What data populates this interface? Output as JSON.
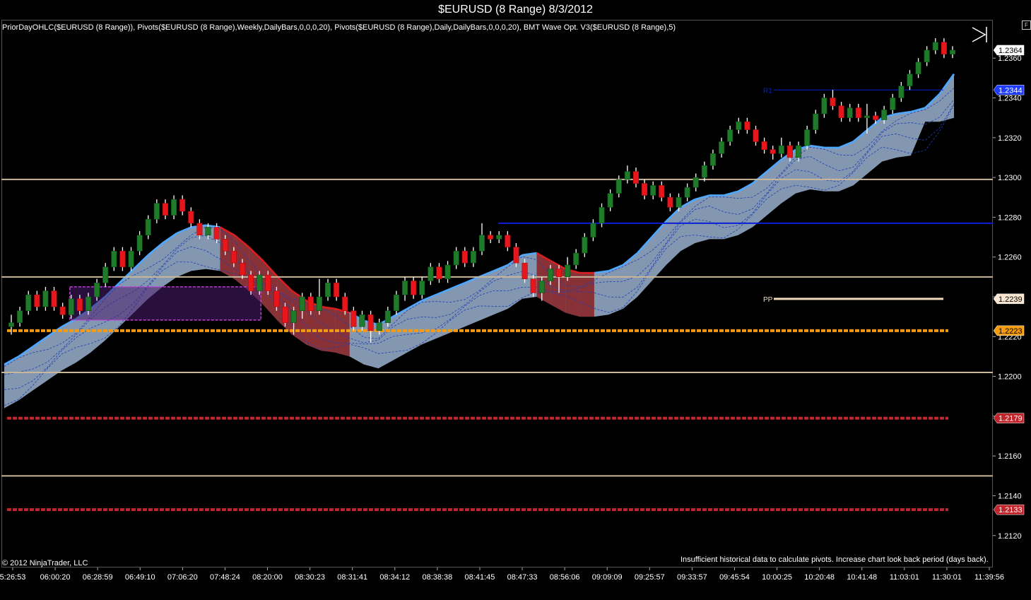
{
  "window": {
    "title": "$EURUSD (8 Range)  8/3/2012"
  },
  "indicators_label": "PriorDayOHLC($EURUSD (8 Range)), Pivots($EURUSD (8 Range),Weekly,DailyBars,0,0,0,20), Pivots($EURUSD (8 Range),Daily,DailyBars,0,0,0,20), BMT Wave Opt. V3($EURUSD (8 Range),5)",
  "corner_button": "F",
  "copyright": "© 2012 NinjaTrader, LLC",
  "pivot_note": "Insufficient historical data to calculate pivots. Increase chart look back period (days back).",
  "colors": {
    "background": "#000000",
    "up_candle": "#1f7a2a",
    "down_candle": "#e8161b",
    "wave_up": "#4fa8ff",
    "wave_down": "#d81e1e",
    "band_fill": "#a9c2e2",
    "resistance": "#0b1fd6",
    "pp_line": "#f4d9bb",
    "orange_level": "#f39c12",
    "red_level": "#c0272d",
    "tan_level": "#c9b79a"
  },
  "chart_data": {
    "type": "candlestick",
    "title": "$EURUSD (8 Range)  8/3/2012",
    "ylim": [
      1.2105,
      1.2375
    ],
    "y_ticks": [
      "1.2120",
      "1.2140",
      "1.2160",
      "1.2180",
      "1.2200",
      "1.2220",
      "1.2240",
      "1.2260",
      "1.2280",
      "1.2300",
      "1.2320",
      "1.2340",
      "1.2360"
    ],
    "x_ticks": [
      "5:26:53",
      "06:00:20",
      "06:28:59",
      "06:49:10",
      "07:06:20",
      "07:48:24",
      "08:20:00",
      "08:30:23",
      "08:31:41",
      "08:34:12",
      "08:38:38",
      "08:41:45",
      "08:47:33",
      "08:56:06",
      "09:09:09",
      "09:25:57",
      "09:33:57",
      "09:45:54",
      "10:00:25",
      "10:20:48",
      "10:41:48",
      "11:03:01",
      "11:30:01",
      "11:39:56"
    ],
    "price_markers": [
      {
        "label": "1.2364",
        "value": 1.2364,
        "color": "#ffffff",
        "text_color": "#000000"
      },
      {
        "label": "1.2344",
        "value": 1.2344,
        "color": "#1f3cff",
        "text_color": "#ffffff"
      },
      {
        "label": "1.2239",
        "value": 1.2239,
        "color": "#f8e6d0",
        "text_color": "#000000"
      },
      {
        "label": "1.2223",
        "value": 1.2223,
        "color": "#f39c12",
        "text_color": "#000000"
      },
      {
        "label": "1.2179",
        "value": 1.2179,
        "color": "#c0272d",
        "text_color": "#ffffff"
      },
      {
        "label": "1.2133",
        "value": 1.2133,
        "color": "#c0272d",
        "text_color": "#ffffff"
      }
    ],
    "levels": [
      {
        "name": "tan-level-1",
        "value": 1.2299,
        "style": "solid",
        "color": "#c9b79a"
      },
      {
        "name": "tan-level-2",
        "value": 1.225,
        "style": "solid",
        "color": "#c9b79a"
      },
      {
        "name": "tan-level-3",
        "value": 1.2202,
        "style": "solid",
        "color": "#c9b79a"
      },
      {
        "name": "tan-level-4",
        "value": 1.215,
        "style": "solid",
        "color": "#c9b79a"
      },
      {
        "name": "blue-resistance",
        "value": 1.2277,
        "style": "solid",
        "color": "#0b1fd6"
      },
      {
        "name": "orange-level",
        "value": 1.2223,
        "style": "dashed",
        "color": "#f39c12"
      },
      {
        "name": "red-level-1",
        "value": 1.2179,
        "style": "dashed",
        "color": "#c0272d"
      },
      {
        "name": "red-level-2",
        "value": 1.2133,
        "style": "dashed",
        "color": "#c0272d"
      }
    ],
    "pivot_labels": [
      {
        "label": "R1",
        "value": 1.2344
      },
      {
        "label": "PP",
        "value": 1.2239
      }
    ],
    "candles": [
      [
        1.2225,
        1.2227,
        1.2231,
        1.2221
      ],
      [
        1.2227,
        1.2233,
        1.2235,
        1.2225
      ],
      [
        1.2233,
        1.2241,
        1.2243,
        1.2231
      ],
      [
        1.2241,
        1.2235,
        1.2243,
        1.2233
      ],
      [
        1.2235,
        1.2243,
        1.2245,
        1.2233
      ],
      [
        1.2243,
        1.2235,
        1.2245,
        1.2233
      ],
      [
        1.2235,
        1.2231,
        1.2237,
        1.2229
      ],
      [
        1.2231,
        1.2239,
        1.2241,
        1.2229
      ],
      [
        1.2239,
        1.2233,
        1.2241,
        1.2231
      ],
      [
        1.2233,
        1.224,
        1.2242,
        1.2231
      ],
      [
        1.224,
        1.2247,
        1.2249,
        1.2238
      ],
      [
        1.2247,
        1.2255,
        1.2257,
        1.2245
      ],
      [
        1.2255,
        1.2263,
        1.2265,
        1.2253
      ],
      [
        1.2263,
        1.2255,
        1.2265,
        1.2253
      ],
      [
        1.2255,
        1.2263,
        1.2265,
        1.2253
      ],
      [
        1.2263,
        1.2271,
        1.2273,
        1.2261
      ],
      [
        1.2271,
        1.2279,
        1.2281,
        1.2269
      ],
      [
        1.2279,
        1.2287,
        1.2289,
        1.2277
      ],
      [
        1.2287,
        1.2281,
        1.2289,
        1.2279
      ],
      [
        1.2281,
        1.2289,
        1.2291,
        1.2279
      ],
      [
        1.2289,
        1.2283,
        1.2291,
        1.2281
      ],
      [
        1.2283,
        1.2277,
        1.2285,
        1.2275
      ],
      [
        1.2277,
        1.2271,
        1.2279,
        1.2269
      ],
      [
        1.2271,
        1.2275,
        1.2277,
        1.2269
      ],
      [
        1.2275,
        1.2269,
        1.2277,
        1.2267
      ],
      [
        1.2269,
        1.2263,
        1.2271,
        1.2261
      ],
      [
        1.2263,
        1.2257,
        1.2265,
        1.2255
      ],
      [
        1.2257,
        1.2251,
        1.2259,
        1.2249
      ],
      [
        1.2251,
        1.2243,
        1.2253,
        1.2241
      ],
      [
        1.2243,
        1.2251,
        1.2253,
        1.2241
      ],
      [
        1.2251,
        1.2243,
        1.2253,
        1.2241
      ],
      [
        1.2243,
        1.2235,
        1.2245,
        1.2233
      ],
      [
        1.2235,
        1.2227,
        1.2237,
        1.2225
      ],
      [
        1.2227,
        1.2233,
        1.2235,
        1.2221
      ],
      [
        1.2233,
        1.224,
        1.2242,
        1.2229
      ],
      [
        1.224,
        1.2233,
        1.2242,
        1.2231
      ],
      [
        1.2233,
        1.224,
        1.2249,
        1.2231
      ],
      [
        1.224,
        1.2247,
        1.2249,
        1.2238
      ],
      [
        1.2247,
        1.224,
        1.2249,
        1.2238
      ],
      [
        1.224,
        1.2233,
        1.2242,
        1.2231
      ],
      [
        1.2233,
        1.2225,
        1.2235,
        1.2223
      ],
      [
        1.2225,
        1.2231,
        1.2233,
        1.2223
      ],
      [
        1.2231,
        1.2223,
        1.2233,
        1.2217
      ],
      [
        1.2223,
        1.2227,
        1.2229,
        1.2221
      ],
      [
        1.2227,
        1.2233,
        1.2235,
        1.2225
      ],
      [
        1.2233,
        1.2241,
        1.2243,
        1.2231
      ],
      [
        1.2241,
        1.2248,
        1.225,
        1.2238
      ],
      [
        1.2248,
        1.2241,
        1.225,
        1.2239
      ],
      [
        1.2241,
        1.2248,
        1.225,
        1.2239
      ],
      [
        1.2248,
        1.2255,
        1.2257,
        1.2246
      ],
      [
        1.2255,
        1.2249,
        1.2257,
        1.2247
      ],
      [
        1.2249,
        1.2256,
        1.2258,
        1.2247
      ],
      [
        1.2256,
        1.2263,
        1.2265,
        1.2254
      ],
      [
        1.2263,
        1.2257,
        1.2265,
        1.2255
      ],
      [
        1.2257,
        1.2263,
        1.2265,
        1.2255
      ],
      [
        1.2263,
        1.2271,
        1.2277,
        1.2261
      ],
      [
        1.2271,
        1.2269,
        1.2273,
        1.2267
      ],
      [
        1.2269,
        1.2271,
        1.2273,
        1.2267
      ],
      [
        1.2271,
        1.2265,
        1.2273,
        1.2263
      ],
      [
        1.2265,
        1.2257,
        1.2267,
        1.2255
      ],
      [
        1.2257,
        1.2249,
        1.2259,
        1.2247
      ],
      [
        1.2249,
        1.2242,
        1.2251,
        1.224
      ],
      [
        1.2242,
        1.2248,
        1.225,
        1.2238
      ],
      [
        1.2248,
        1.2254,
        1.2256,
        1.2246
      ],
      [
        1.2254,
        1.225,
        1.2256,
        1.2242
      ],
      [
        1.225,
        1.2256,
        1.226,
        1.2248
      ],
      [
        1.2256,
        1.2262,
        1.2264,
        1.2254
      ],
      [
        1.2262,
        1.227,
        1.2272,
        1.226
      ],
      [
        1.227,
        1.2277,
        1.2279,
        1.2268
      ],
      [
        1.2277,
        1.2285,
        1.2287,
        1.2275
      ],
      [
        1.2285,
        1.2292,
        1.2294,
        1.2283
      ],
      [
        1.2292,
        1.2299,
        1.2301,
        1.229
      ],
      [
        1.2299,
        1.2303,
        1.2306,
        1.2297
      ],
      [
        1.2303,
        1.2297,
        1.2305,
        1.2295
      ],
      [
        1.2297,
        1.2291,
        1.2299,
        1.2289
      ],
      [
        1.2291,
        1.2296,
        1.2298,
        1.2289
      ],
      [
        1.2296,
        1.229,
        1.2298,
        1.2288
      ],
      [
        1.229,
        1.2285,
        1.2292,
        1.2283
      ],
      [
        1.2285,
        1.229,
        1.2292,
        1.2283
      ],
      [
        1.229,
        1.2295,
        1.2297,
        1.2288
      ],
      [
        1.2295,
        1.23,
        1.2302,
        1.2293
      ],
      [
        1.23,
        1.2306,
        1.2308,
        1.2298
      ],
      [
        1.2306,
        1.2312,
        1.2314,
        1.2304
      ],
      [
        1.2312,
        1.2318,
        1.232,
        1.231
      ],
      [
        1.2318,
        1.2324,
        1.2326,
        1.2316
      ],
      [
        1.2324,
        1.2328,
        1.233,
        1.2322
      ],
      [
        1.2328,
        1.2324,
        1.233,
        1.2322
      ],
      [
        1.2324,
        1.2318,
        1.2326,
        1.2316
      ],
      [
        1.2318,
        1.2314,
        1.232,
        1.2312
      ],
      [
        1.2314,
        1.2312,
        1.2316,
        1.2309
      ],
      [
        1.2312,
        1.2316,
        1.232,
        1.231
      ],
      [
        1.2316,
        1.231,
        1.2318,
        1.2308
      ],
      [
        1.231,
        1.2316,
        1.2318,
        1.2308
      ],
      [
        1.2316,
        1.2324,
        1.2326,
        1.2314
      ],
      [
        1.2324,
        1.2332,
        1.2334,
        1.2322
      ],
      [
        1.2332,
        1.234,
        1.2342,
        1.233
      ],
      [
        1.234,
        1.2336,
        1.2344,
        1.2334
      ],
      [
        1.2336,
        1.233,
        1.2338,
        1.2328
      ],
      [
        1.233,
        1.2335,
        1.2337,
        1.2328
      ],
      [
        1.2335,
        1.233,
        1.2337,
        1.2328
      ],
      [
        1.233,
        1.2331,
        1.2337,
        1.2322
      ],
      [
        1.2331,
        1.2329,
        1.2333,
        1.2327
      ],
      [
        1.2329,
        1.2334,
        1.2336,
        1.2327
      ],
      [
        1.2334,
        1.234,
        1.2342,
        1.2332
      ],
      [
        1.234,
        1.2346,
        1.2348,
        1.2338
      ],
      [
        1.2346,
        1.2352,
        1.2354,
        1.2344
      ],
      [
        1.2352,
        1.2358,
        1.236,
        1.235
      ],
      [
        1.2358,
        1.2364,
        1.2366,
        1.2356
      ],
      [
        1.2364,
        1.2368,
        1.237,
        1.2362
      ],
      [
        1.2368,
        1.2362,
        1.237,
        1.236
      ],
      [
        1.2362,
        1.2364,
        1.2366,
        1.236
      ]
    ],
    "wave_centerline": [
      1.2206,
      1.221,
      1.2215,
      1.222,
      1.2225,
      1.2229,
      1.2234,
      1.224,
      1.2247,
      1.2254,
      1.2261,
      1.2267,
      1.2272,
      1.2275,
      1.2276,
      1.2275,
      1.2271,
      1.2265,
      1.2258,
      1.225,
      1.2243,
      1.2238,
      1.2235,
      1.2234,
      1.2232,
      1.2228,
      1.2226,
      1.223,
      1.2234,
      1.2238,
      1.2241,
      1.2244,
      1.2247,
      1.225,
      1.2253,
      1.2256,
      1.2261,
      1.2262,
      1.2258,
      1.2254,
      1.2252,
      1.2252,
      1.2253,
      1.2256,
      1.2262,
      1.227,
      1.2278,
      1.2285,
      1.2289,
      1.2291,
      1.2291,
      1.2293,
      1.2297,
      1.2303,
      1.2309,
      1.2314,
      1.2316,
      1.2315,
      1.2315,
      1.2318,
      1.2324,
      1.233,
      1.2332,
      1.2333,
      1.2335,
      1.2342,
      1.2352
    ],
    "wave_direction": [
      "up",
      "up",
      "up",
      "up",
      "up",
      "up",
      "up",
      "up",
      "up",
      "up",
      "up",
      "up",
      "up",
      "up",
      "up",
      "down",
      "down",
      "down",
      "down",
      "down",
      "down",
      "down",
      "down",
      "down",
      "up",
      "up",
      "up",
      "up",
      "up",
      "up",
      "up",
      "up",
      "up",
      "up",
      "up",
      "up",
      "up",
      "down",
      "down",
      "down",
      "down",
      "up",
      "up",
      "up",
      "up",
      "up",
      "up",
      "up",
      "up",
      "up",
      "up",
      "up",
      "up",
      "up",
      "up",
      "up",
      "up",
      "up",
      "up",
      "up",
      "up",
      "up",
      "up",
      "up",
      "up",
      "up",
      "up"
    ],
    "wave_lower_offset": 0.0022,
    "highlight_box": {
      "x0": 8,
      "x1": 30,
      "y0": 1.2245,
      "y1": 1.2234
    },
    "band_tail_min": 1.2328
  }
}
